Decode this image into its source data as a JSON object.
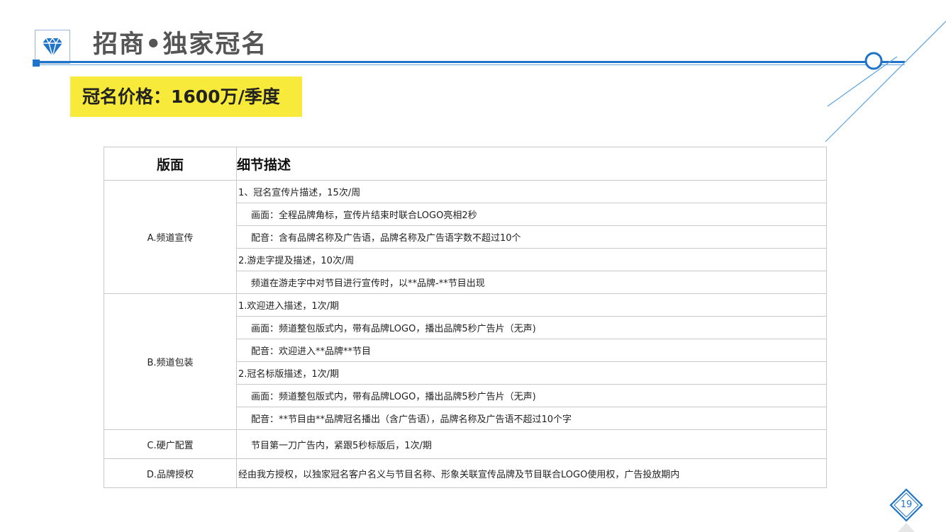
{
  "header": {
    "title": "招商•独家冠名",
    "icon": "diamond-icon"
  },
  "price_banner": {
    "text": "冠名价格：1600万/季度"
  },
  "table": {
    "headers": [
      "版面",
      "细节描述"
    ],
    "sections": [
      {
        "name": "A.频道宣传",
        "lines": [
          "1、冠名宣传片描述，15次/周",
          "画面：全程品牌角标，宣传片结束时联合LOGO亮相2秒",
          "配音：含有品牌名称及广告语，品牌名称及广告语字数不超过10个",
          "2.游走字提及描述，10次/周",
          "频道在游走字中对节目进行宣传时，以**品牌-**节目出现"
        ]
      },
      {
        "name": "B.频道包装",
        "lines": [
          "1.欢迎进入描述，1次/期",
          "画面：频道整包版式内，带有品牌LOGO，播出品牌5秒广告片（无声)",
          "配音：欢迎进入**品牌**节目",
          "2.冠名标版描述，1次/期",
          "画面：频道整包版式内，带有品牌LOGO，播出品牌5秒广告片（无声)",
          "配音：**节目由**品牌冠名播出（含广告语），品牌名称及广告语不超过10个字"
        ]
      },
      {
        "name": "C.硬广配置",
        "lines": [
          "节目第一刀广告内，紧跟5秒标版后，1次/期"
        ]
      },
      {
        "name": "D.品牌授权",
        "lines": [
          "经由我方授权，以独家冠名客户名义与节目名称、形象关联宣传品牌及节目联合LOGO使用权，广告投放期内"
        ]
      }
    ]
  },
  "footer": {
    "page_number": "19"
  },
  "colors": {
    "accent_blue": "#1f73c9",
    "banner_yellow": "#f7ea3a",
    "title_gray": "#555555"
  }
}
